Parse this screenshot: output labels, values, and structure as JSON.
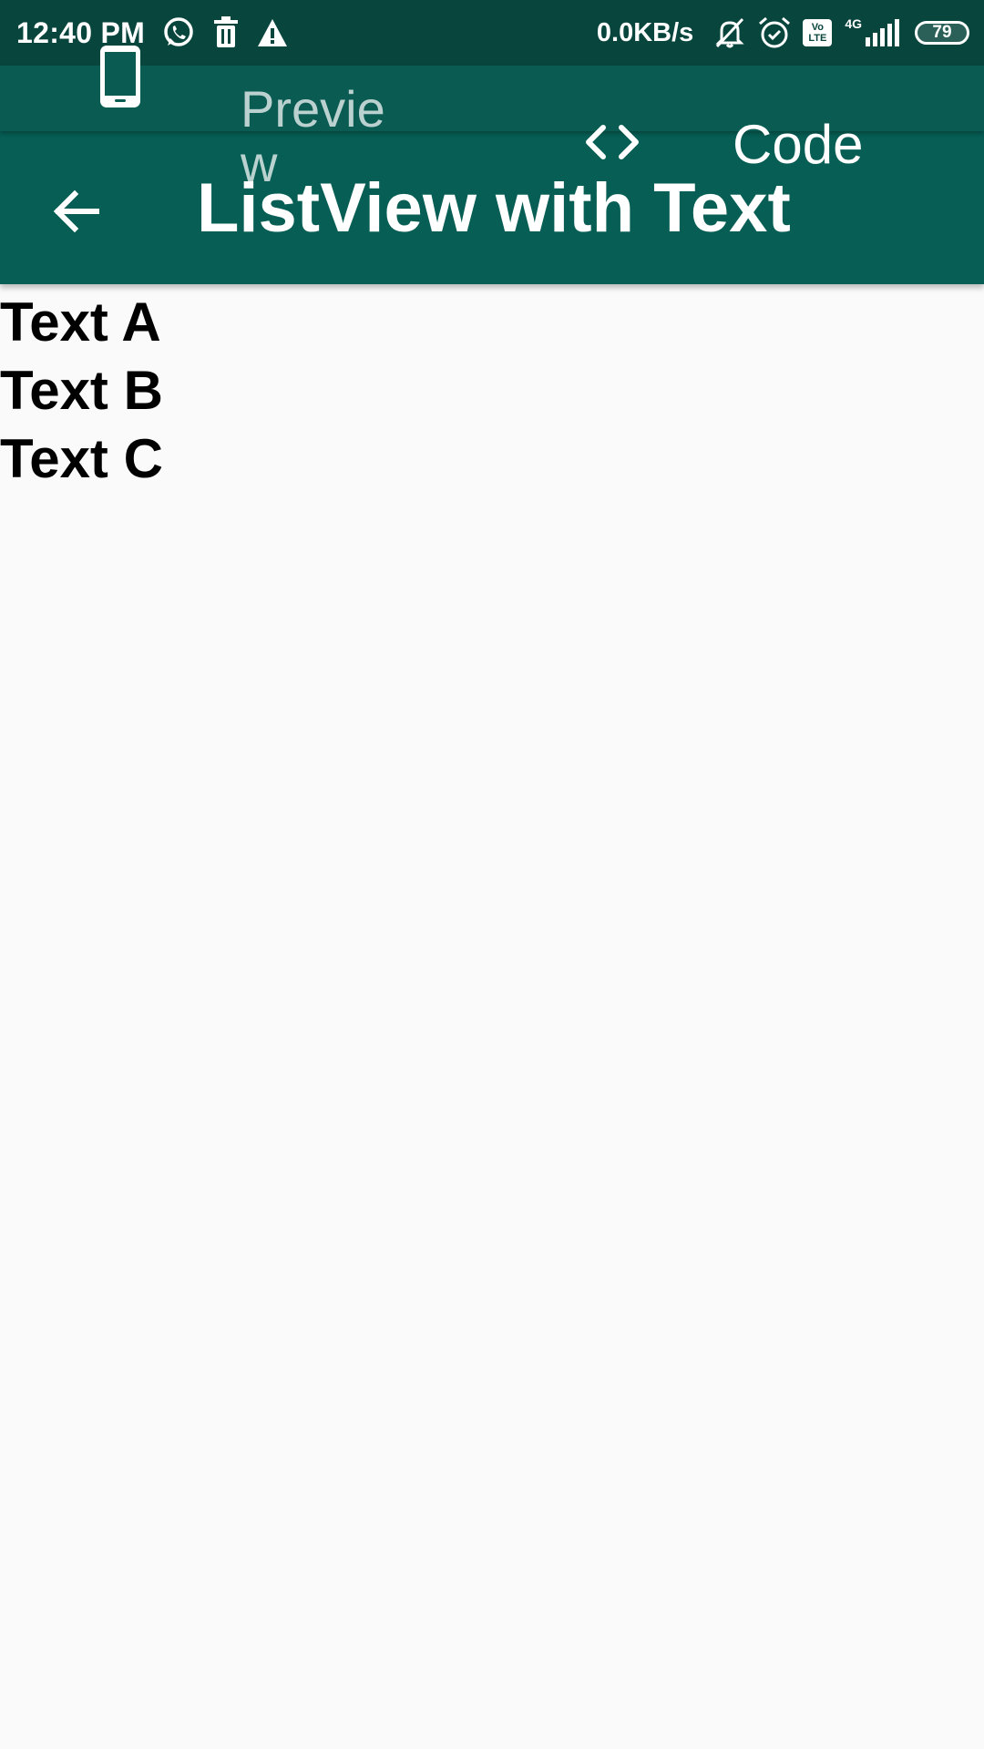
{
  "status_bar": {
    "time": "12:40 PM",
    "net_speed": "0.0KB/s",
    "volte_top": "Vo",
    "volte_bottom": "LTE",
    "net_type": "4G",
    "battery": "79",
    "icons": [
      "whatsapp-icon",
      "delete-icon",
      "warning-icon",
      "muted-bell-icon",
      "alarm-icon",
      "signal-icon"
    ]
  },
  "mode_bar": {
    "preview_label": "Preview",
    "code_label": "Code"
  },
  "app_bar": {
    "title": "ListView with Text"
  },
  "list": {
    "items": [
      "Text A",
      "Text B",
      "Text C"
    ]
  },
  "colors": {
    "status_bar": "#07453d",
    "mode_bar": "#0a5c53",
    "app_bar": "#065e54",
    "background": "#fafafa"
  }
}
